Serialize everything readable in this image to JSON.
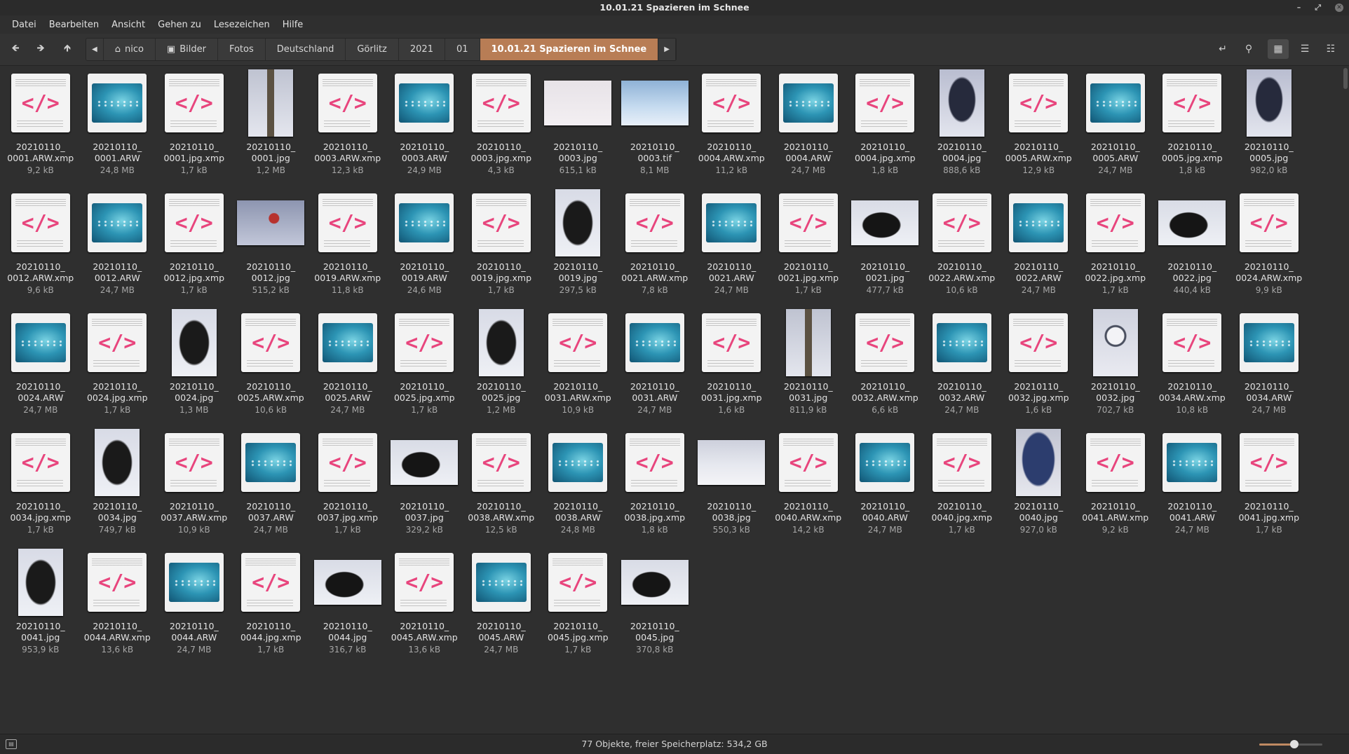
{
  "window": {
    "title": "10.01.21 Spazieren im Schnee"
  },
  "menu": [
    "Datei",
    "Bearbeiten",
    "Ansicht",
    "Gehen zu",
    "Lesezeichen",
    "Hilfe"
  ],
  "breadcrumbs": [
    "nico",
    "Bilder",
    "Fotos",
    "Deutschland",
    "Görlitz",
    "2021",
    "01",
    "10.01.21 Spazieren im Schnee"
  ],
  "status": {
    "text": "77 Objekte, freier Speicherplatz: 534,2 GB",
    "zoom_level": 0.55
  },
  "accent_color": "#b87d55",
  "files": [
    {
      "name": "20210110_0001.ARW.xmp",
      "size": "9,2 kB",
      "kind": "xmp"
    },
    {
      "name": "20210110_0001.ARW",
      "size": "24,8 MB",
      "kind": "arw"
    },
    {
      "name": "20210110_0001.jpg.xmp",
      "size": "1,7 kB",
      "kind": "xmp"
    },
    {
      "name": "20210110_0001.jpg",
      "size": "1,2 MB",
      "kind": "post"
    },
    {
      "name": "20210110_0003.ARW.xmp",
      "size": "12,3 kB",
      "kind": "xmp"
    },
    {
      "name": "20210110_0003.ARW",
      "size": "24,9 MB",
      "kind": "arw"
    },
    {
      "name": "20210110_0003.jpg.xmp",
      "size": "4,3 kB",
      "kind": "xmp"
    },
    {
      "name": "20210110_0003.jpg",
      "size": "615,1 kB",
      "kind": "snow-wide"
    },
    {
      "name": "20210110_0003.tif",
      "size": "8,1 MB",
      "kind": "tif"
    },
    {
      "name": "20210110_0004.ARW.xmp",
      "size": "11,2 kB",
      "kind": "xmp"
    },
    {
      "name": "20210110_0004.ARW",
      "size": "24,7 MB",
      "kind": "arw"
    },
    {
      "name": "20210110_0004.jpg.xmp",
      "size": "1,8 kB",
      "kind": "xmp"
    },
    {
      "name": "20210110_0004.jpg",
      "size": "888,6 kB",
      "kind": "person"
    },
    {
      "name": "20210110_0005.ARW.xmp",
      "size": "12,9 kB",
      "kind": "xmp"
    },
    {
      "name": "20210110_0005.ARW",
      "size": "24,7 MB",
      "kind": "arw"
    },
    {
      "name": "20210110_0005.jpg.xmp",
      "size": "1,8 kB",
      "kind": "xmp"
    },
    {
      "name": "20210110_0005.jpg",
      "size": "982,0 kB",
      "kind": "person"
    },
    {
      "name": "20210110_0012.ARW.xmp",
      "size": "9,6 kB",
      "kind": "xmp"
    },
    {
      "name": "20210110_0012.ARW",
      "size": "24,7 MB",
      "kind": "arw"
    },
    {
      "name": "20210110_0012.jpg.xmp",
      "size": "1,7 kB",
      "kind": "xmp"
    },
    {
      "name": "20210110_0012.jpg",
      "size": "515,2 kB",
      "kind": "berry"
    },
    {
      "name": "20210110_0019.ARW.xmp",
      "size": "11,8 kB",
      "kind": "xmp"
    },
    {
      "name": "20210110_0019.ARW",
      "size": "24,6 MB",
      "kind": "arw"
    },
    {
      "name": "20210110_0019.jpg.xmp",
      "size": "1,7 kB",
      "kind": "xmp"
    },
    {
      "name": "20210110_0019.jpg",
      "size": "297,5 kB",
      "kind": "dog-tall"
    },
    {
      "name": "20210110_0021.ARW.xmp",
      "size": "7,8 kB",
      "kind": "xmp"
    },
    {
      "name": "20210110_0021.ARW",
      "size": "24,7 MB",
      "kind": "arw"
    },
    {
      "name": "20210110_0021.jpg.xmp",
      "size": "1,7 kB",
      "kind": "xmp"
    },
    {
      "name": "20210110_0021.jpg",
      "size": "477,7 kB",
      "kind": "dog-wide"
    },
    {
      "name": "20210110_0022.ARW.xmp",
      "size": "10,6 kB",
      "kind": "xmp"
    },
    {
      "name": "20210110_0022.ARW",
      "size": "24,7 MB",
      "kind": "arw"
    },
    {
      "name": "20210110_0022.jpg.xmp",
      "size": "1,7 kB",
      "kind": "xmp"
    },
    {
      "name": "20210110_0022.jpg",
      "size": "440,4 kB",
      "kind": "dog-wide"
    },
    {
      "name": "20210110_0024.ARW.xmp",
      "size": "9,9 kB",
      "kind": "xmp"
    },
    {
      "name": "20210110_0024.ARW",
      "size": "24,7 MB",
      "kind": "arw"
    },
    {
      "name": "20210110_0024.jpg.xmp",
      "size": "1,7 kB",
      "kind": "xmp"
    },
    {
      "name": "20210110_0024.jpg",
      "size": "1,3 MB",
      "kind": "dog-tall"
    },
    {
      "name": "20210110_0025.ARW.xmp",
      "size": "10,6 kB",
      "kind": "xmp"
    },
    {
      "name": "20210110_0025.ARW",
      "size": "24,7 MB",
      "kind": "arw"
    },
    {
      "name": "20210110_0025.jpg.xmp",
      "size": "1,7 kB",
      "kind": "xmp"
    },
    {
      "name": "20210110_0025.jpg",
      "size": "1,2 MB",
      "kind": "dog-tall"
    },
    {
      "name": "20210110_0031.ARW.xmp",
      "size": "10,9 kB",
      "kind": "xmp"
    },
    {
      "name": "20210110_0031.ARW",
      "size": "24,7 MB",
      "kind": "arw"
    },
    {
      "name": "20210110_0031.jpg.xmp",
      "size": "1,6 kB",
      "kind": "xmp"
    },
    {
      "name": "20210110_0031.jpg",
      "size": "811,9 kB",
      "kind": "post"
    },
    {
      "name": "20210110_0032.ARW.xmp",
      "size": "6,6 kB",
      "kind": "xmp"
    },
    {
      "name": "20210110_0032.ARW",
      "size": "24,7 MB",
      "kind": "arw"
    },
    {
      "name": "20210110_0032.jpg.xmp",
      "size": "1,6 kB",
      "kind": "xmp"
    },
    {
      "name": "20210110_0032.jpg",
      "size": "702,7 kB",
      "kind": "flower"
    },
    {
      "name": "20210110_0034.ARW.xmp",
      "size": "10,8 kB",
      "kind": "xmp"
    },
    {
      "name": "20210110_0034.ARW",
      "size": "24,7 MB",
      "kind": "arw"
    },
    {
      "name": "20210110_0034.jpg.xmp",
      "size": "1,7 kB",
      "kind": "xmp"
    },
    {
      "name": "20210110_0034.jpg",
      "size": "749,7 kB",
      "kind": "dog-tall"
    },
    {
      "name": "20210110_0037.ARW.xmp",
      "size": "10,9 kB",
      "kind": "xmp"
    },
    {
      "name": "20210110_0037.ARW",
      "size": "24,7 MB",
      "kind": "arw"
    },
    {
      "name": "20210110_0037.jpg.xmp",
      "size": "1,7 kB",
      "kind": "xmp"
    },
    {
      "name": "20210110_0037.jpg",
      "size": "329,2 kB",
      "kind": "dog-wide"
    },
    {
      "name": "20210110_0038.ARW.xmp",
      "size": "12,5 kB",
      "kind": "xmp"
    },
    {
      "name": "20210110_0038.ARW",
      "size": "24,8 MB",
      "kind": "arw"
    },
    {
      "name": "20210110_0038.jpg.xmp",
      "size": "1,8 kB",
      "kind": "xmp"
    },
    {
      "name": "20210110_0038.jpg",
      "size": "550,3 kB",
      "kind": "field"
    },
    {
      "name": "20210110_0040.ARW.xmp",
      "size": "14,2 kB",
      "kind": "xmp"
    },
    {
      "name": "20210110_0040.ARW",
      "size": "24,7 MB",
      "kind": "arw"
    },
    {
      "name": "20210110_0040.jpg.xmp",
      "size": "1,7 kB",
      "kind": "xmp"
    },
    {
      "name": "20210110_0040.jpg",
      "size": "927,0 kB",
      "kind": "person-blue"
    },
    {
      "name": "20210110_0041.ARW.xmp",
      "size": "9,2 kB",
      "kind": "xmp"
    },
    {
      "name": "20210110_0041.ARW",
      "size": "24,7 MB",
      "kind": "arw"
    },
    {
      "name": "20210110_0041.jpg.xmp",
      "size": "1,7 kB",
      "kind": "xmp"
    },
    {
      "name": "20210110_0041.jpg",
      "size": "953,9 kB",
      "kind": "dog-tall"
    },
    {
      "name": "20210110_0044.ARW.xmp",
      "size": "13,6 kB",
      "kind": "xmp"
    },
    {
      "name": "20210110_0044.ARW",
      "size": "24,7 MB",
      "kind": "arw"
    },
    {
      "name": "20210110_0044.jpg.xmp",
      "size": "1,7 kB",
      "kind": "xmp"
    },
    {
      "name": "20210110_0044.jpg",
      "size": "316,7 kB",
      "kind": "dog-wide"
    },
    {
      "name": "20210110_0045.ARW.xmp",
      "size": "13,6 kB",
      "kind": "xmp"
    },
    {
      "name": "20210110_0045.ARW",
      "size": "24,7 MB",
      "kind": "arw"
    },
    {
      "name": "20210110_0045.jpg.xmp",
      "size": "1,7 kB",
      "kind": "xmp"
    },
    {
      "name": "20210110_0045.jpg",
      "size": "370,8 kB",
      "kind": "dog-wide"
    }
  ]
}
